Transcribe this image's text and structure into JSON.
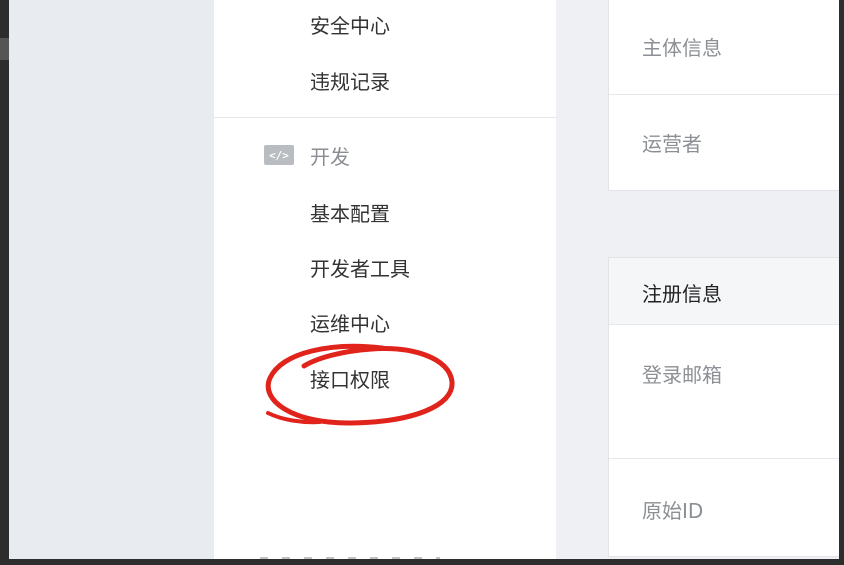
{
  "sidebar": {
    "items_top": [
      {
        "label": "安全中心"
      },
      {
        "label": "违规记录"
      }
    ],
    "section": {
      "icon": "code-icon",
      "icon_text": "</>",
      "title": "开发"
    },
    "items_dev": [
      {
        "label": "基本配置"
      },
      {
        "label": "开发者工具"
      },
      {
        "label": "运维中心"
      },
      {
        "label": "接口权限"
      }
    ]
  },
  "annotation": {
    "color": "#e0241c",
    "target": "接口权限"
  },
  "content": {
    "card1": {
      "rows": [
        {
          "label": "主体信息"
        },
        {
          "label": "运营者"
        }
      ]
    },
    "card2": {
      "header": "注册信息",
      "rows": [
        {
          "label": "登录邮箱"
        },
        {
          "label": "原始ID"
        }
      ]
    }
  },
  "colors": {
    "accent_edge": "#c9a56a",
    "sidebar_bg": "#ffffff",
    "page_bg": "#eef0f3"
  }
}
